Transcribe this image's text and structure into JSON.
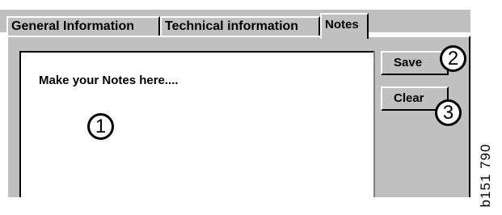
{
  "tabs": [
    {
      "label": "General Information",
      "active": false
    },
    {
      "label": "Technical information",
      "active": false
    },
    {
      "label": "Notes",
      "active": true
    }
  ],
  "notes": {
    "text": "Make your Notes here...."
  },
  "buttons": {
    "save_label": "Save",
    "clear_label": "Clear"
  },
  "callouts": [
    "1",
    "2",
    "3"
  ],
  "figure_code": "b151 790",
  "colors": {
    "face": "#c0c0c0",
    "highlight": "#ffffff",
    "shadow": "#000000",
    "text": "#000000"
  }
}
